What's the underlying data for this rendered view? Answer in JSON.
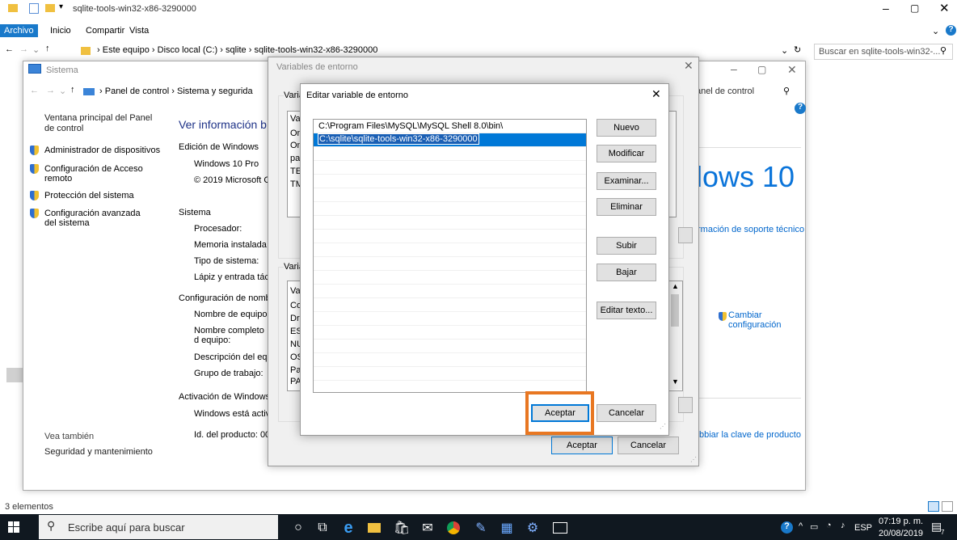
{
  "explorer": {
    "title": "sqlite-tools-win32-x86-3290000",
    "ribbon_tabs": [
      "Archivo",
      "Inicio",
      "Compartir",
      "Vista"
    ],
    "breadcrumb": [
      "Este equipo",
      "Disco local (C:)",
      "sqlite",
      "sqlite-tools-win32-x86-3290000"
    ],
    "search_placeholder": "Buscar en sqlite-tools-win32-... ",
    "status": "3 elementos"
  },
  "sistema": {
    "title": "Sistema",
    "breadcrumb": [
      "Panel de control",
      "Sistema y segurida"
    ],
    "search_placeholder": "el Panel de control",
    "left_home": "Ventana principal del Panel de control",
    "left_links": [
      "Administrador de dispositivos",
      "Configuración de Acceso remoto",
      "Protección del sistema",
      "Configuración avanzada del sistema"
    ],
    "see_also": "Vea también",
    "see_also_link": "Seguridad y mantenimiento",
    "heading": "Ver información b",
    "edition_title": "Edición de Windows",
    "edition": "Windows 10 Pro",
    "copyright": "© 2019 Microsoft C",
    "system_title": "Sistema",
    "system_rows": [
      "Procesador:",
      "Memoria instalada (",
      "Tipo de sistema:",
      "Lápiz y entrada tácti"
    ],
    "names_title": "Configuración de nomb",
    "names_rows": [
      "Nombre de equipo:",
      "Nombre completo d equipo:",
      "Descripción del equ",
      "Grupo de trabajo:"
    ],
    "activation_title": "Activación de Windows",
    "activation_rows": [
      "Windows está activa",
      "Id. del producto: 00"
    ],
    "win10_logo": "lows 10",
    "support_link": "rmación de soporte técnico",
    "change_config": "Cambiar configuración",
    "product_key": "bbiar la clave de producto"
  },
  "entorno": {
    "title": "Variables de entorno",
    "group_user": "Varia",
    "group_sys": "Varia",
    "user_frag": [
      "Va",
      "On",
      "On",
      "pa",
      "TE",
      "TM"
    ],
    "sys_frag": [
      "Va",
      "Co",
      "Dr",
      "ES",
      "NU",
      "OS",
      "Pa",
      "PA"
    ],
    "ok": "Aceptar",
    "cancel": "Cancelar"
  },
  "editar": {
    "title": "Editar variable de entorno",
    "items": [
      "C:\\Program Files\\MySQL\\MySQL Shell 8.0\\bin\\",
      "C:\\sqlite\\sqlite-tools-win32-x86-3290000"
    ],
    "buttons": [
      "Nuevo",
      "Modificar",
      "Examinar...",
      "Eliminar",
      "Subir",
      "Bajar",
      "Editar texto..."
    ],
    "ok": "Aceptar",
    "cancel": "Cancelar",
    "highlight_color": "#e87722"
  },
  "taskbar": {
    "search_placeholder": "Escribe aquí para buscar",
    "lang": "ESP",
    "time": "07:19 p. m.",
    "date": "20/08/2019",
    "notif_count": "7"
  }
}
